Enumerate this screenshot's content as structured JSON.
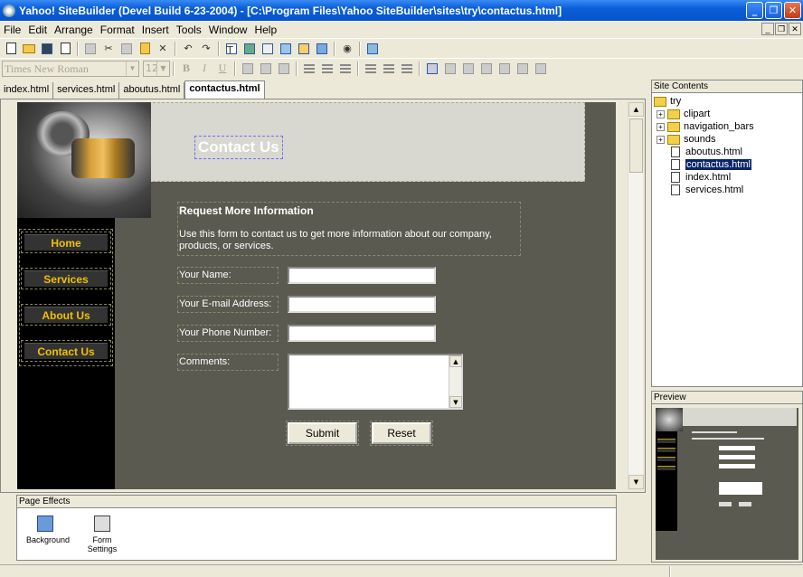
{
  "window": {
    "title": "Yahoo! SiteBuilder (Devel Build 6-23-2004) - [C:\\Program Files\\Yahoo SiteBuilder\\sites\\try\\contactus.html]"
  },
  "menu": [
    "File",
    "Edit",
    "Arrange",
    "Format",
    "Insert",
    "Tools",
    "Window",
    "Help"
  ],
  "format_toolbar": {
    "font": "Times New Roman",
    "size": "12",
    "bold": "B",
    "italic": "I",
    "underline": "U"
  },
  "tabs": [
    {
      "label": "index.html",
      "active": false
    },
    {
      "label": "services.html",
      "active": false
    },
    {
      "label": "aboutus.html",
      "active": false
    },
    {
      "label": "contactus.html",
      "active": true
    }
  ],
  "page": {
    "header_title": "Contact Us",
    "nav": [
      "Home",
      "Services",
      "About Us",
      "Contact Us"
    ],
    "form": {
      "heading": "Request More Information",
      "intro": "Use this form to contact us to get more information about our company, products, or services.",
      "fields": [
        "Your Name:",
        "Your E-mail Address:",
        "Your Phone Number:",
        "Comments:"
      ],
      "submit": "Submit",
      "reset": "Reset"
    }
  },
  "page_effects": {
    "header": "Page Effects",
    "items": [
      "Background",
      "Form Settings"
    ]
  },
  "site_contents": {
    "header": "Site Contents",
    "root": "try",
    "folders": [
      "clipart",
      "navigation_bars",
      "sounds"
    ],
    "files": [
      "aboutus.html",
      "contactus.html",
      "index.html",
      "services.html"
    ],
    "selected": "contactus.html"
  },
  "preview": {
    "header": "Preview"
  },
  "colors": {
    "titlebar": "#0553cc",
    "canvas_bg": "#5a5a50",
    "nav_text": "#f0c000",
    "selection": "#0a246a"
  }
}
